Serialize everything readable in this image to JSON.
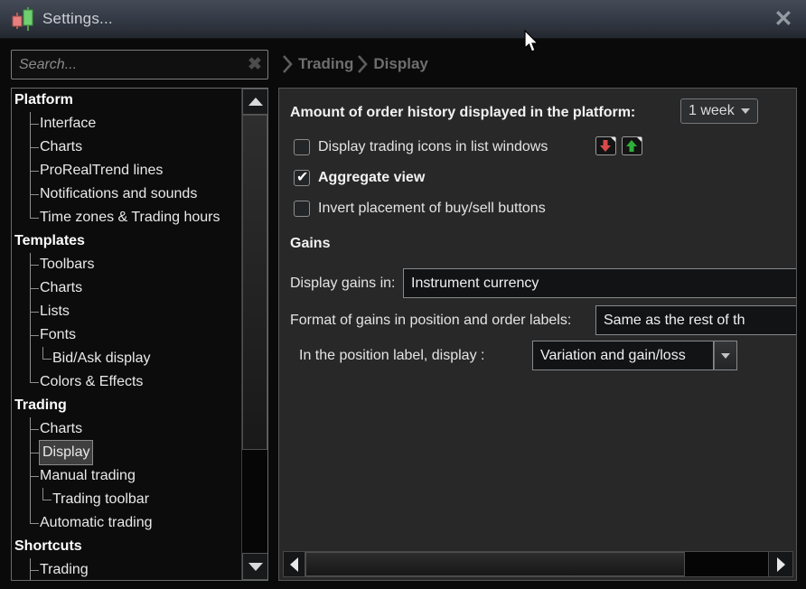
{
  "window": {
    "title": "Settings...",
    "close_glyph": "✕"
  },
  "search": {
    "placeholder": "Search...",
    "clear_glyph": "✖"
  },
  "breadcrumb": {
    "items": [
      {
        "label": "Trading"
      },
      {
        "label": "Display"
      }
    ]
  },
  "tree": {
    "items": [
      {
        "label": "Platform",
        "level": 0,
        "bold": true
      },
      {
        "label": "Interface",
        "level": 1,
        "tee": "mid"
      },
      {
        "label": "Charts",
        "level": 1,
        "tee": "mid"
      },
      {
        "label": "ProRealTrend lines",
        "level": 1,
        "tee": "mid"
      },
      {
        "label": "Notifications and sounds",
        "level": 1,
        "tee": "mid"
      },
      {
        "label": "Time zones & Trading hours",
        "level": 1,
        "tee": "end"
      },
      {
        "label": "Templates",
        "level": 0,
        "bold": true
      },
      {
        "label": "Toolbars",
        "level": 1,
        "tee": "mid"
      },
      {
        "label": "Charts",
        "level": 1,
        "tee": "mid"
      },
      {
        "label": "Lists",
        "level": 1,
        "tee": "mid"
      },
      {
        "label": "Fonts",
        "level": 1,
        "tee": "mid"
      },
      {
        "label": "Bid/Ask display",
        "level": 2,
        "tee": "end",
        "cont": true
      },
      {
        "label": "Colors & Effects",
        "level": 1,
        "tee": "end"
      },
      {
        "label": "Trading",
        "level": 0,
        "bold": true
      },
      {
        "label": "Charts",
        "level": 1,
        "tee": "mid"
      },
      {
        "label": "Display",
        "level": 1,
        "tee": "mid",
        "selected": true
      },
      {
        "label": "Manual trading",
        "level": 1,
        "tee": "mid"
      },
      {
        "label": "Trading toolbar",
        "level": 2,
        "tee": "end",
        "cont": true
      },
      {
        "label": "Automatic trading",
        "level": 1,
        "tee": "end"
      },
      {
        "label": "Shortcuts",
        "level": 0,
        "bold": true
      },
      {
        "label": "Trading",
        "level": 1,
        "tee": "mid"
      }
    ]
  },
  "panel": {
    "order_history": {
      "label": "Amount of order history displayed in the platform:",
      "value": "1 week"
    },
    "checkboxes": [
      {
        "label": "Display trading icons in list windows",
        "checked": false,
        "bold": false
      },
      {
        "label": "Aggregate view",
        "checked": true,
        "bold": true
      },
      {
        "label": "Invert placement of buy/sell buttons",
        "checked": false,
        "bold": false
      }
    ],
    "trading_icons": {
      "sell_color": "#d94b4b",
      "buy_color": "#2fae3a"
    },
    "gains": {
      "heading": "Gains",
      "display_gains_in": {
        "label": "Display gains in:",
        "value": "Instrument currency"
      },
      "format_labels": {
        "label": "Format of gains in position and order labels:",
        "value": "Same as the rest of th"
      },
      "position_label": {
        "label": "In the position label, display :",
        "value": "Variation and gain/loss"
      }
    }
  },
  "glyphs": {
    "check": "✔"
  }
}
